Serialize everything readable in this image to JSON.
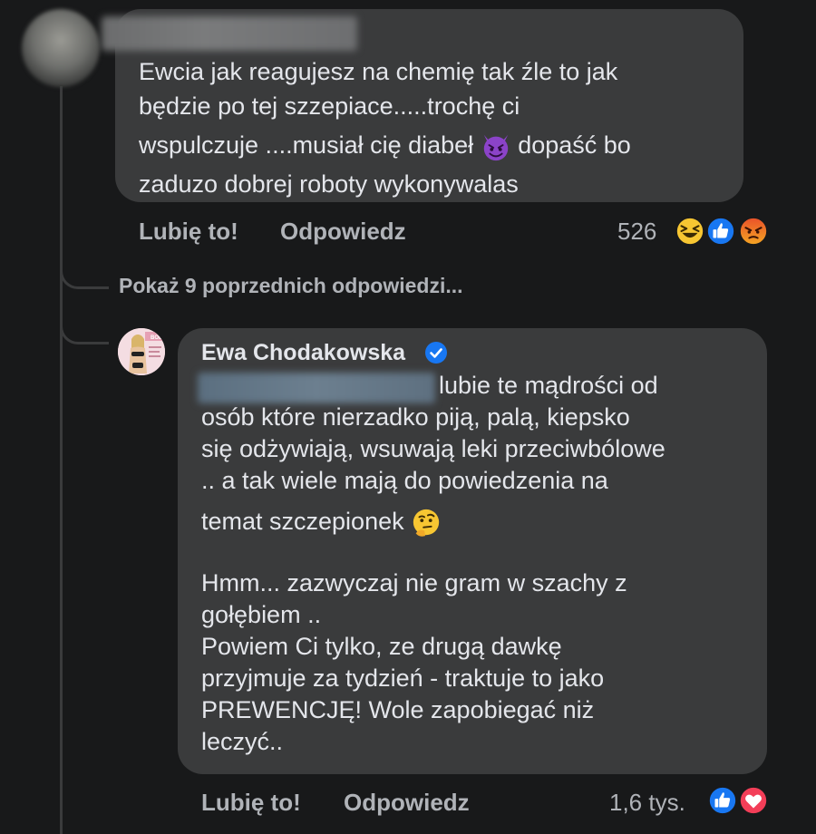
{
  "comment_1": {
    "lines": [
      "Ewcia jak reagujesz na chemię tak źle to jak",
      "będzie po tej szzepiace.....trochę ci",
      "wspulczuje ....musiał cię diabeł",
      "dopaść bo",
      "zaduzo dobrej roboty wykonywalas"
    ],
    "emoji": "devil-face-emoji",
    "like_label": "Lubię to!",
    "reply_label": "Odpowiedz",
    "reaction_count": "526",
    "reactions": [
      "laughing-emoji",
      "like-icon",
      "angry-emoji"
    ]
  },
  "show_more": "Pokaż 9 poprzednich odpowiedzi...",
  "comment_2": {
    "author": "Ewa Chodakowska",
    "verified_icon": "verified-badge-icon",
    "lines": [
      "lubie te mądrości od",
      "osób które nierzadko piją, palą, kiepsko",
      "się odżywiają, wsuwają leki przeciwbólowe",
      ".. a tak wiele mają do powiedzenia na",
      "temat szczepionek"
    ],
    "emoji": "thinking-face-emoji",
    "lines_2": [
      "Hmm... zazwyczaj nie gram w szachy z",
      "gołębiem ..",
      "Powiem Ci tylko, ze drugą dawkę",
      "przyjmuje za tydzień - traktuje to jako",
      "PREWENCJĘ! Wole zapobiegać niż",
      "leczyć.."
    ],
    "like_label": "Lubię to!",
    "reply_label": "Odpowiedz",
    "reaction_count": "1,6 tys.",
    "reactions": [
      "like-icon",
      "love-icon"
    ]
  },
  "colors": {
    "background": "#18191a",
    "bubble": "#3a3b3c",
    "text": "#e4e6eb",
    "secondary": "#b0b3b8",
    "like_blue": "#1877f2",
    "love_red": "#f33e58"
  }
}
